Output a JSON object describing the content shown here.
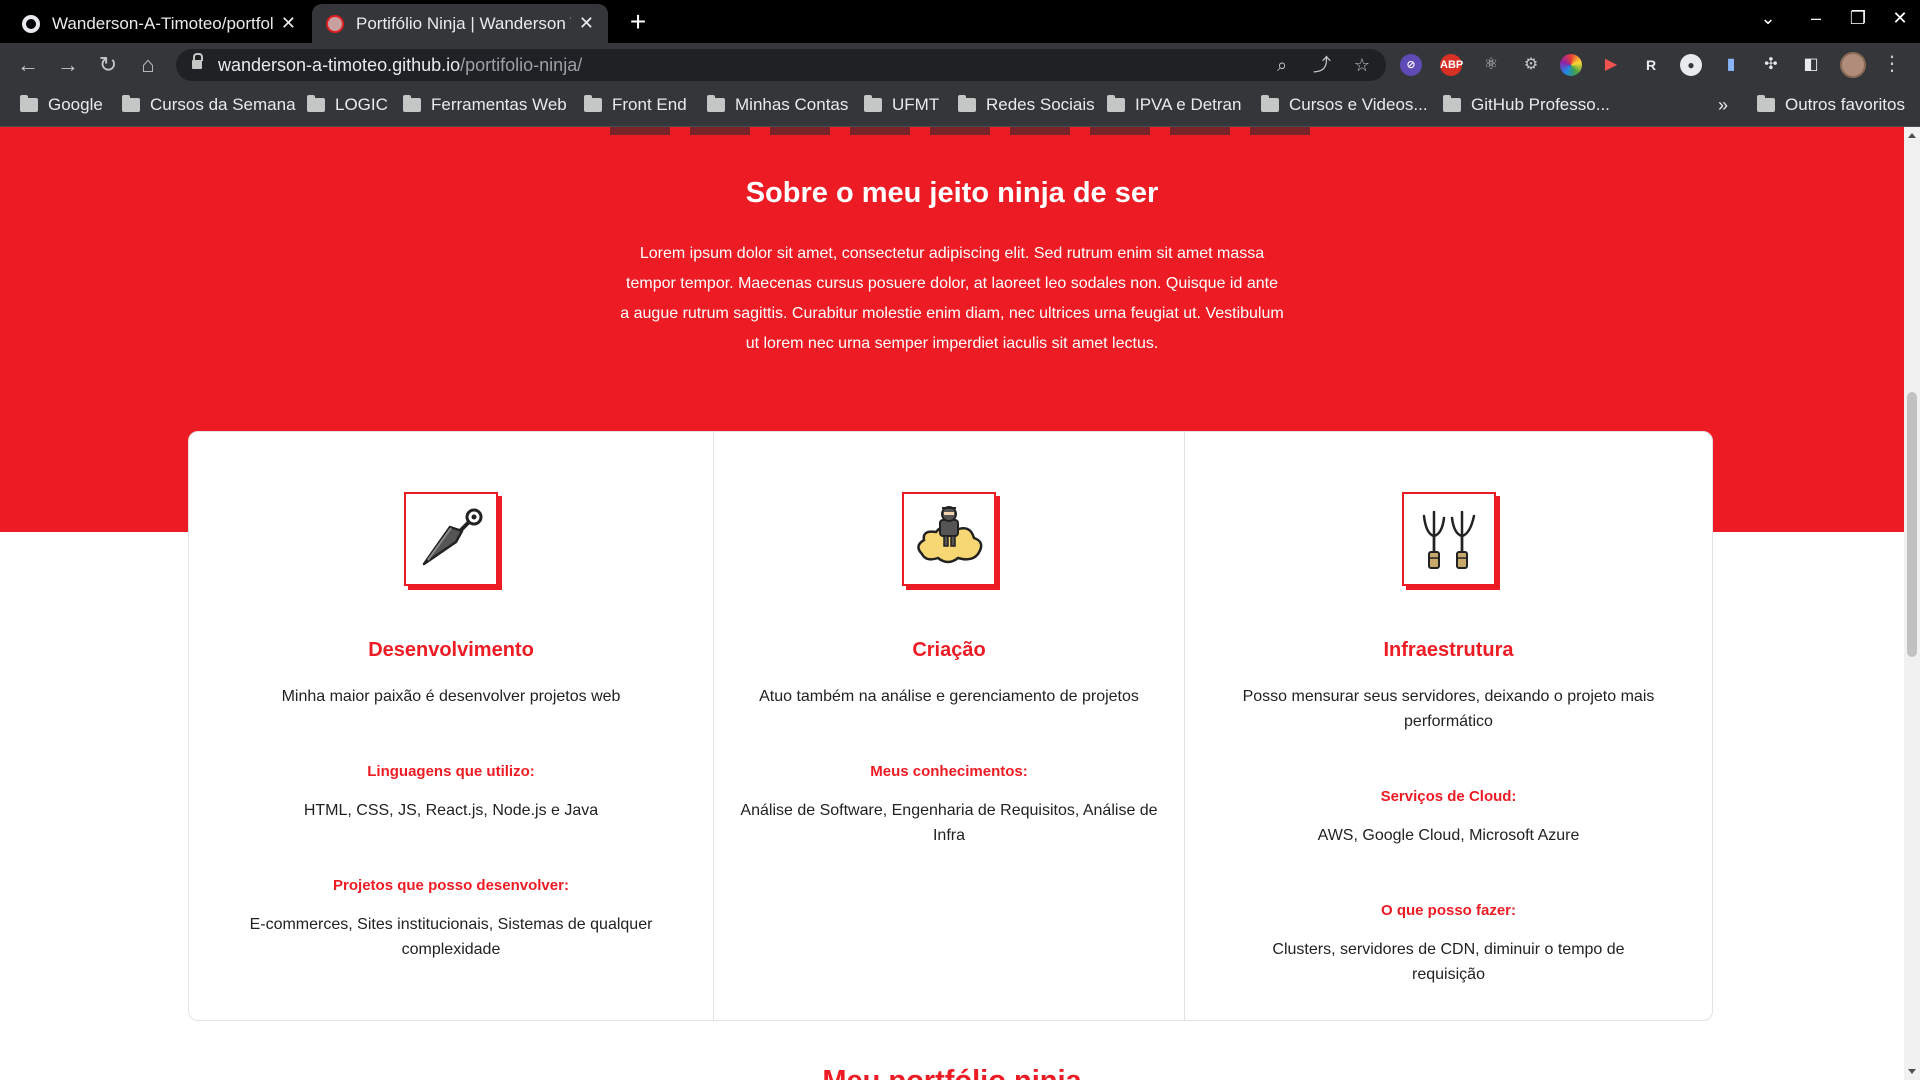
{
  "browser": {
    "tabs": [
      {
        "title": "Wanderson-A-Timoteo/portfolio-ninja",
        "active": false
      },
      {
        "title": "Portifólio Ninja | Wanderson Timoteo",
        "active": true
      }
    ],
    "url_host": "wanderson-a-timoteo.github.io",
    "url_path": "/portifolio-ninja/",
    "bookmarks": [
      "Google",
      "Cursos da Semana",
      "LOGIC",
      "Ferramentas Web",
      "Front End",
      "Minhas Contas",
      "UFMT",
      "Redes Sociais",
      "IPVA e Detran",
      "Cursos e Videos...",
      "GitHub Professo..."
    ],
    "other_bookmarks": "Outros favoritos",
    "more_bookmarks": "»",
    "new_tab": "+",
    "close_glyph": "✕",
    "ext_abp": "ABP"
  },
  "hero": {
    "title": "Sobre o meu jeito ninja de ser",
    "text": "Lorem ipsum dolor sit amet, consectetur adipiscing elit. Sed rutrum enim sit amet massa tempor tempor. Maecenas cursus posuere dolor, at laoreet leo sodales non. Quisque id ante a augue rutrum sagittis. Curabitur molestie enim diam, nec ultrices urna feugiat ut. Vestibulum ut lorem nec urna semper imperdiet iaculis sit amet lectus.",
    "background_color": "#ed1c24"
  },
  "cards": [
    {
      "icon": "kunai-icon",
      "title": "Desenvolvimento",
      "description": "Minha maior paixão é desenvolver projetos web",
      "sections": [
        {
          "heading": "Linguagens que utilizo:",
          "text": "HTML, CSS, JS, React.js, Node.js e Java"
        },
        {
          "heading": "Projetos que posso desenvolver:",
          "text": "E-commerces, Sites institucionais, Sistemas de qualquer complexidade"
        }
      ]
    },
    {
      "icon": "ninja-on-cloud-icon",
      "title": "Criação",
      "description": "Atuo também na análise e gerenciamento de projetos",
      "sections": [
        {
          "heading": "Meus conhecimentos:",
          "text": "Análise de Software, Engenharia de Requisitos, Análise de Infra"
        }
      ]
    },
    {
      "icon": "sai-weapons-icon",
      "title": "Infraestrutura",
      "description": "Posso mensurar seus servidores, deixando o projeto mais performático",
      "sections": [
        {
          "heading": "Serviços de Cloud:",
          "text": "AWS, Google Cloud, Microsoft Azure"
        },
        {
          "heading": "O que posso fazer:",
          "text": "Clusters, servidores de CDN, diminuir o tempo de requisição"
        }
      ]
    }
  ],
  "next_section_title": "Meu portfólio ninja",
  "accent_color": "#ed1c24"
}
